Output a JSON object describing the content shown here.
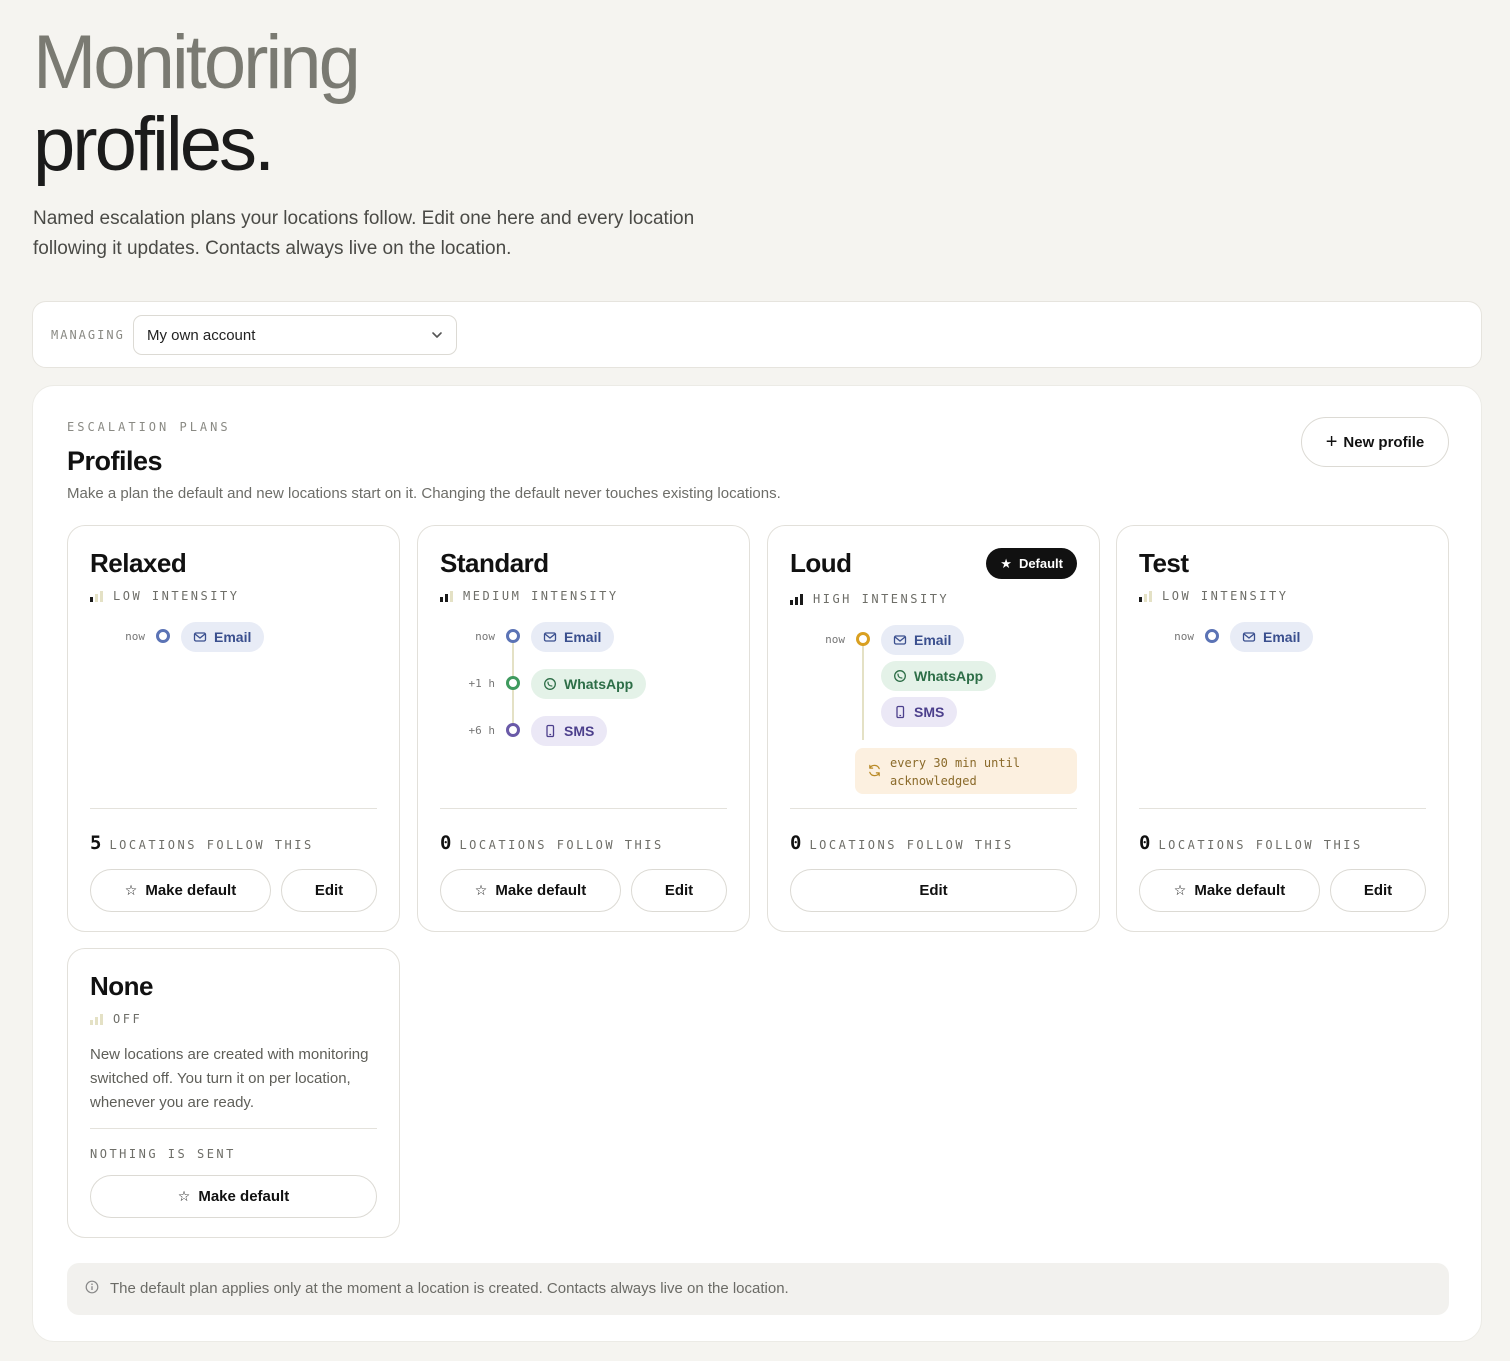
{
  "hero": {
    "title_line1": "Monitoring",
    "title_line2": "profiles.",
    "lede": "Named escalation plans your locations follow. Edit one here and every location following it updates. Contacts always live on the location."
  },
  "managing": {
    "label": "MANAGING",
    "selected": "My own account",
    "icon": "chevron-down-icon"
  },
  "panel": {
    "eyebrow": "ESCALATION PLANS",
    "title": "Profiles",
    "subtitle": "Make a plan the default and new locations start on it. Changing the default never touches existing locations.",
    "new_button": "New profile",
    "new_button_icon": "+"
  },
  "profiles": [
    {
      "name": "Relaxed",
      "intensity": "LOW INTENSITY",
      "level": 1,
      "steps": [
        {
          "when": "now",
          "channel": "Email"
        }
      ],
      "count": "5",
      "follow_label": "LOCATIONS FOLLOW THIS",
      "make_default": "Make default",
      "edit": "Edit"
    },
    {
      "name": "Standard",
      "intensity": "MEDIUM INTENSITY",
      "level": 2,
      "steps": [
        {
          "when": "now",
          "channel": "Email"
        },
        {
          "when": "+1 h",
          "channel": "WhatsApp"
        },
        {
          "when": "+6 h",
          "channel": "SMS"
        }
      ],
      "count": "0",
      "follow_label": "LOCATIONS FOLLOW THIS",
      "make_default": "Make default",
      "edit": "Edit"
    },
    {
      "name": "Loud",
      "badge": "Default",
      "intensity": "HIGH INTENSITY",
      "level": 3,
      "steps": [
        {
          "when": "now",
          "channel": "Email"
        },
        {
          "when": "",
          "channel": "WhatsApp"
        },
        {
          "when": "",
          "channel": "SMS"
        }
      ],
      "repeat": "every 30 min until acknowledged",
      "count": "0",
      "follow_label": "LOCATIONS FOLLOW THIS",
      "edit": "Edit"
    },
    {
      "name": "Test",
      "intensity": "LOW INTENSITY",
      "level": 1,
      "steps": [
        {
          "when": "now",
          "channel": "Email"
        }
      ],
      "count": "0",
      "follow_label": "LOCATIONS FOLLOW THIS",
      "make_default": "Make default",
      "edit": "Edit"
    },
    {
      "name": "None",
      "intensity": "OFF",
      "level": 0,
      "description": "New locations are created with monitoring switched off. You turn it on per location, whenever you are ready.",
      "nothing": "NOTHING IS SENT",
      "make_default": "Make default"
    }
  ],
  "note": {
    "text": "The default plan applies only at the moment a location is created. Contacts always live on the location.",
    "icon": "info-icon"
  },
  "colors": {
    "email": "#3a4f8e",
    "whatsapp": "#2d6e47",
    "sms": "#4c3f8c",
    "repeat": "#d9a021",
    "background": "#f5f4f0"
  }
}
